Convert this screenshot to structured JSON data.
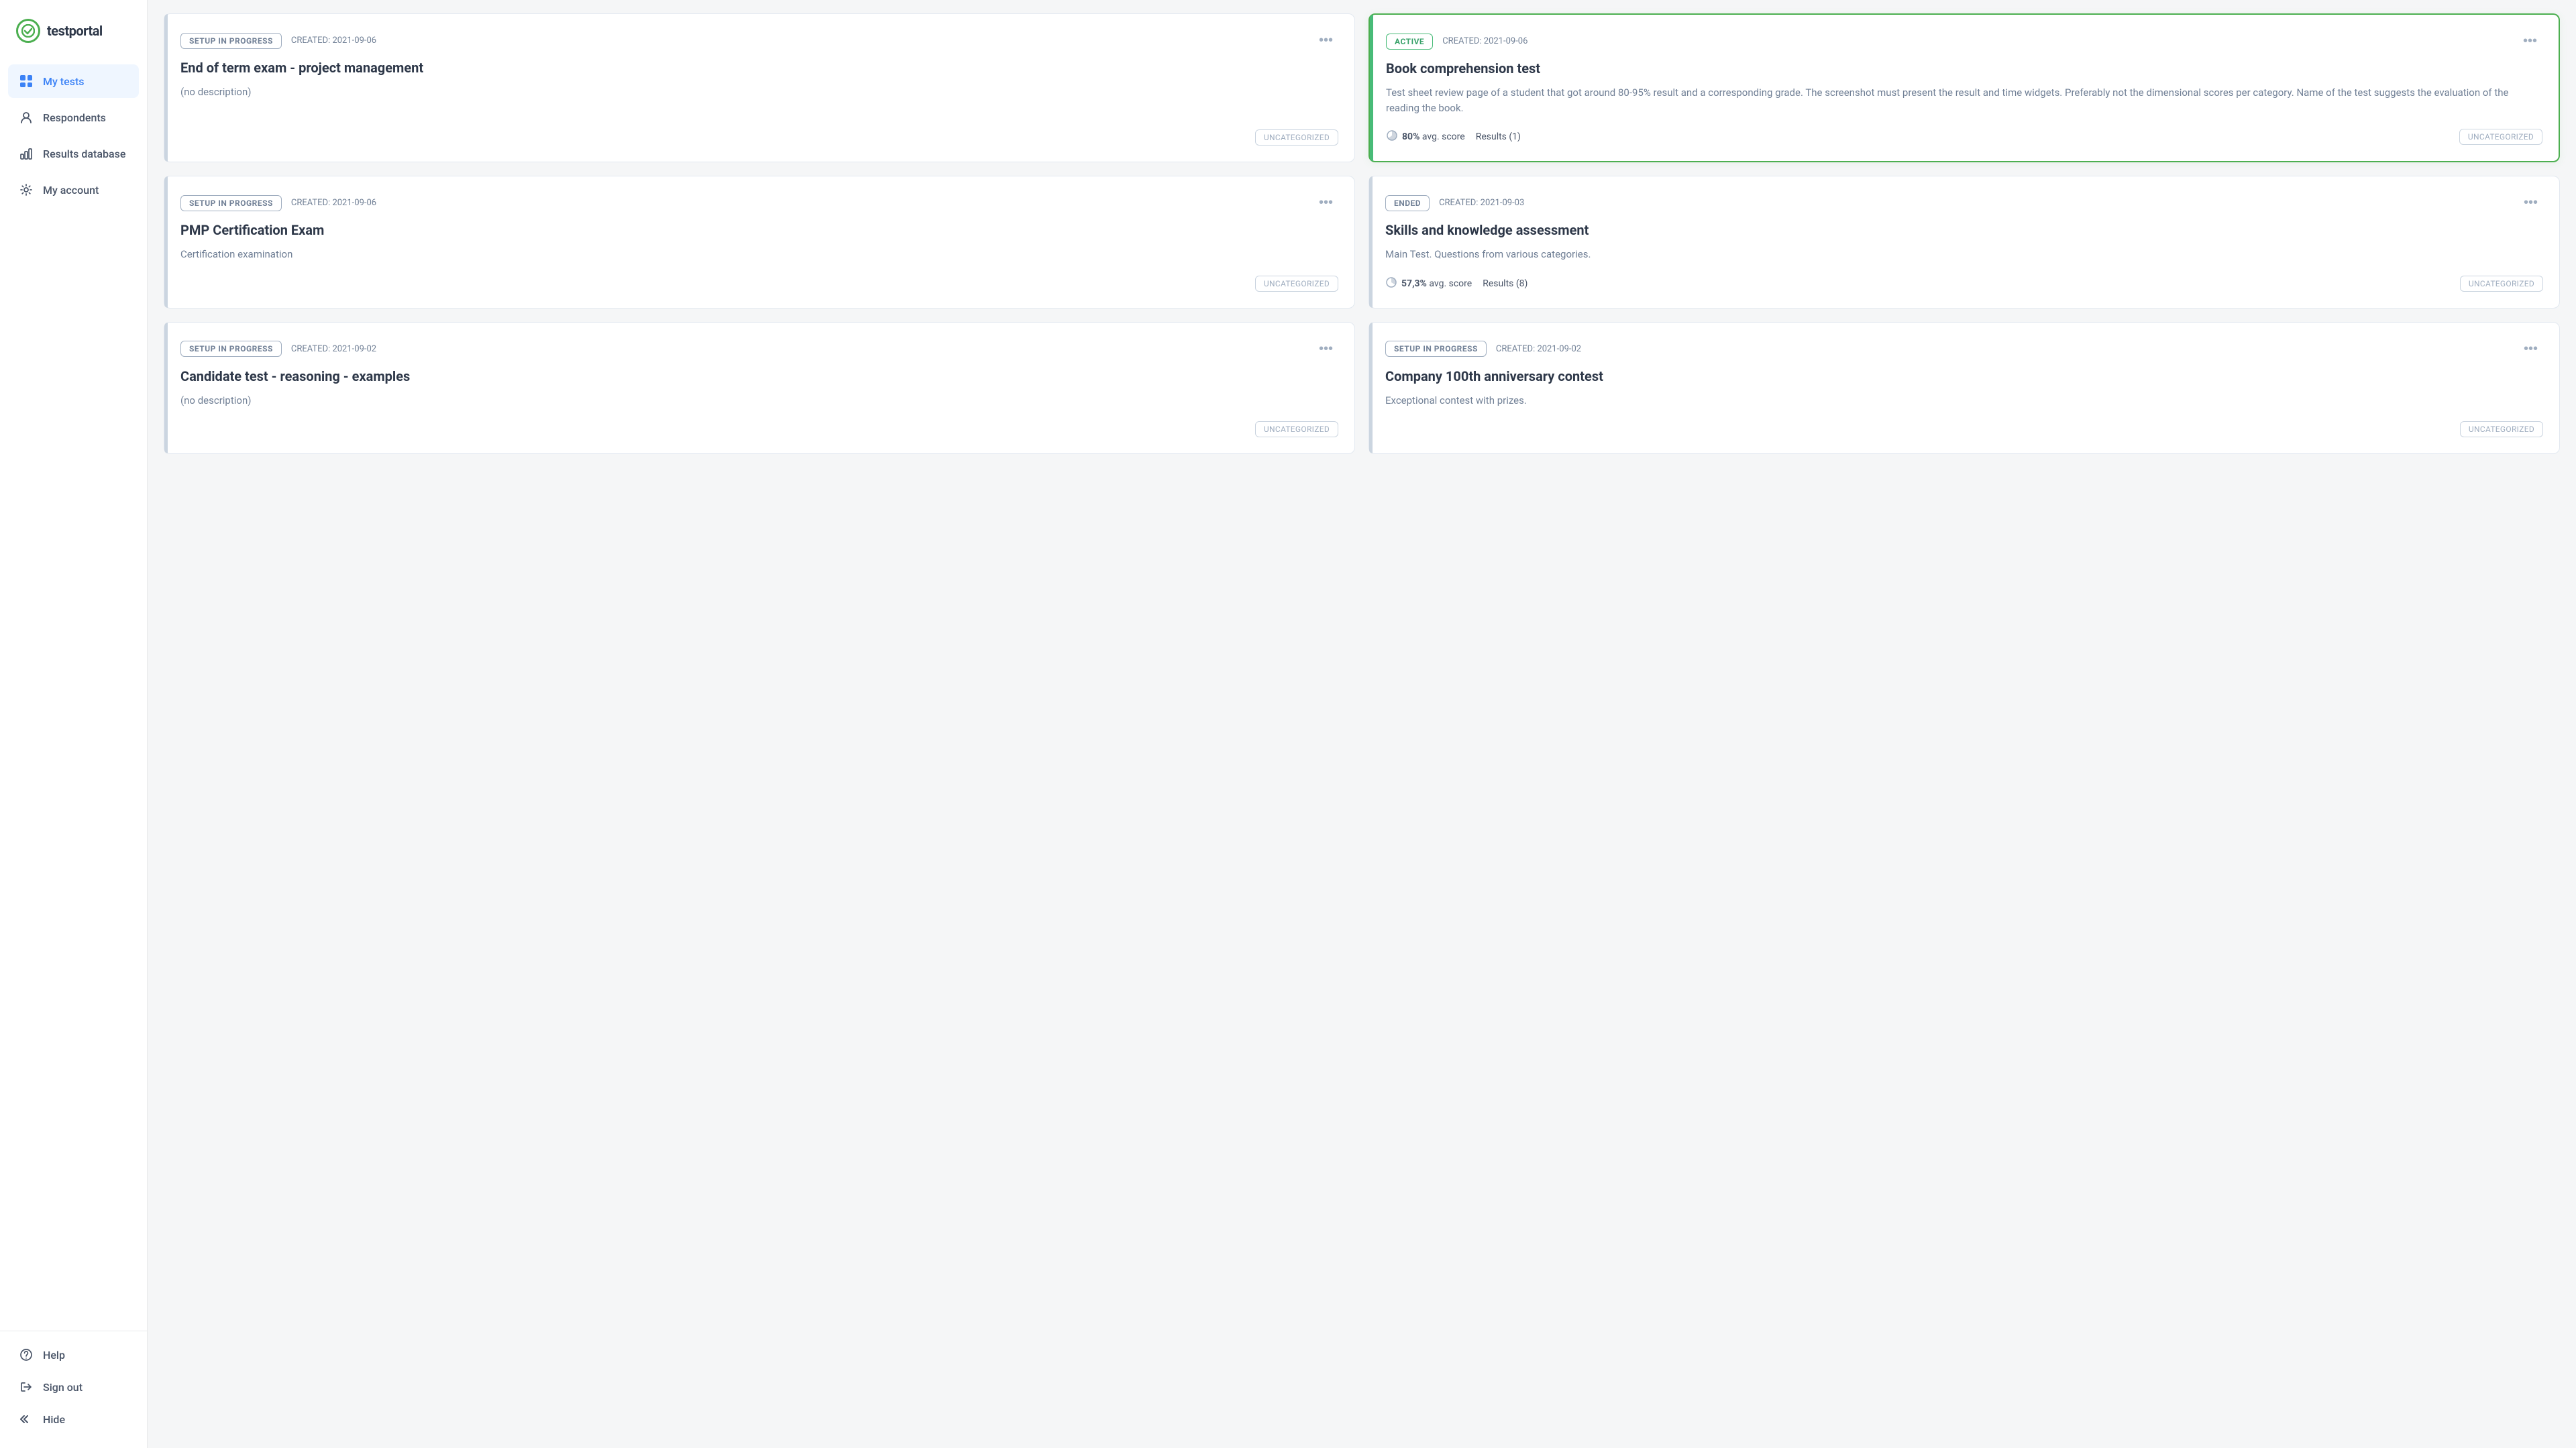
{
  "brand": {
    "logo_text": "testportal",
    "logo_check": "✓"
  },
  "sidebar": {
    "nav_items": [
      {
        "id": "my-tests",
        "label": "My tests",
        "icon": "grid",
        "active": true
      },
      {
        "id": "respondents",
        "label": "Respondents",
        "icon": "person"
      },
      {
        "id": "results-database",
        "label": "Results database",
        "icon": "chart"
      },
      {
        "id": "my-account",
        "label": "My account",
        "icon": "gear"
      }
    ],
    "bottom_items": [
      {
        "id": "help",
        "label": "Help",
        "icon": "question"
      },
      {
        "id": "sign-out",
        "label": "Sign out",
        "icon": "arrow-left"
      }
    ],
    "hide_label": "Hide"
  },
  "cards": [
    {
      "id": "card-1",
      "status": "SETUP IN PROGRESS",
      "status_type": "setup",
      "created": "CREATED: 2021-09-06",
      "title": "End of term exam - project management",
      "description": "(no description)",
      "has_stats": false,
      "category": "UNCATEGORIZED",
      "accent": "gray"
    },
    {
      "id": "card-2",
      "status": "ACTIVE",
      "status_type": "active",
      "created": "CREATED: 2021-09-06",
      "title": "Book comprehension test",
      "description": "Test sheet review page of a student that got around 80-95% result and a corresponding grade. The screenshot must present the result and time widgets. Preferably not the dimensional scores per category. Name of the test suggests the evaluation of the reading the book.",
      "has_stats": true,
      "avg_score": "80%",
      "results": "Results (1)",
      "category": "UNCATEGORIZED",
      "accent": "green"
    },
    {
      "id": "card-3",
      "status": "SETUP IN PROGRESS",
      "status_type": "setup",
      "created": "CREATED: 2021-09-06",
      "title": "PMP Certification Exam",
      "description": "Certification examination",
      "has_stats": false,
      "category": "UNCATEGORIZED",
      "accent": "gray"
    },
    {
      "id": "card-4",
      "status": "ENDED",
      "status_type": "ended",
      "created": "CREATED: 2021-09-03",
      "title": "Skills and knowledge assessment",
      "description": "Main Test. Questions from various categories.",
      "has_stats": true,
      "avg_score": "57,3%",
      "results": "Results (8)",
      "category": "UNCATEGORIZED",
      "accent": "gray"
    },
    {
      "id": "card-5",
      "status": "SETUP IN PROGRESS",
      "status_type": "setup",
      "created": "CREATED: 2021-09-02",
      "title": "Candidate test - reasoning - examples",
      "description": "(no description)",
      "has_stats": false,
      "category": "UNCATEGORIZED",
      "accent": "gray"
    },
    {
      "id": "card-6",
      "status": "SETUP IN PROGRESS",
      "status_type": "setup",
      "created": "CREATED: 2021-09-02",
      "title": "Company 100th anniversary contest",
      "description": "Exceptional contest with prizes.",
      "has_stats": false,
      "category": "UNCATEGORIZED",
      "accent": "gray"
    }
  ]
}
